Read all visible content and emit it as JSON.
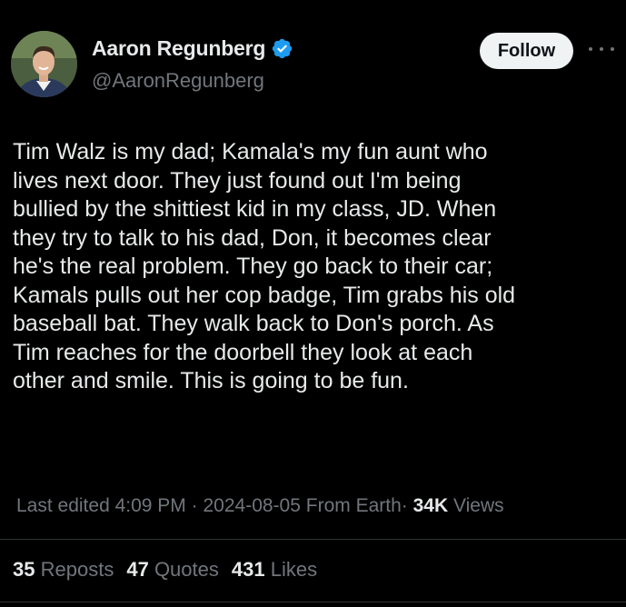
{
  "author": {
    "display_name": "Aaron Regunberg",
    "handle": "@AaronRegunberg",
    "verified": true
  },
  "follow_button": {
    "label": "Follow"
  },
  "tweet_text": "Tim Walz is my dad; Kamala's my fun aunt who\nlives next door. They just found out I'm being\nbullied by the shittiest kid in my class, JD. When\nthey try to talk to his dad, Don, it becomes clear\nhe's the real problem. They go back to their car;\nKamals pulls out her cop badge, Tim grabs his old\nbaseball bat. They walk back to Don's porch. As\nTim reaches for the doorbell they look at each\nother and smile. This is going to be fun.",
  "meta": {
    "edited_label": "Last edited 4:09 PM",
    "separator": "·",
    "date": "2024-08-05",
    "source": "From Earth",
    "views_count": "34K",
    "views_label": "Views"
  },
  "stats": {
    "reposts_count": "35",
    "reposts_label": "Reposts",
    "quotes_count": "47",
    "quotes_label": "Quotes",
    "likes_count": "431",
    "likes_label": "Likes"
  },
  "colors": {
    "background": "#000000",
    "text_primary": "#e7e9ea",
    "text_secondary": "#71767b",
    "verified_blue": "#1d9bf0",
    "divider": "#2f3336",
    "follow_bg": "#eff3f4"
  },
  "icons": {
    "verified": "verified-badge-icon",
    "more": "more-options-icon"
  }
}
